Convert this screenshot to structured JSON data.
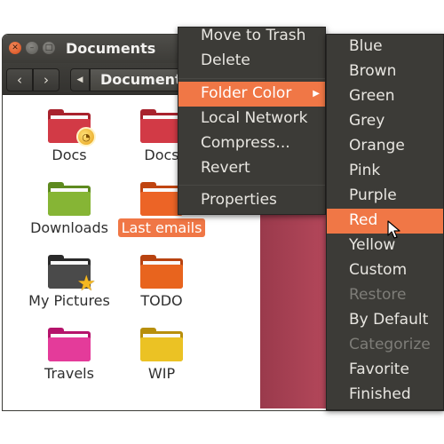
{
  "window": {
    "title": "Documents",
    "breadcrumb": "Documents"
  },
  "files": [
    {
      "name": "Docs",
      "color": "#c8303c",
      "emblem": "clock-emblem"
    },
    {
      "name": "Docs",
      "color": "#c8303c",
      "emblem": ""
    },
    {
      "name": "Downloads",
      "color": "#7cab2f",
      "emblem": ""
    },
    {
      "name": "Last emails",
      "color": "#e85b20",
      "emblem": "",
      "selected": true
    },
    {
      "name": "My Pictures",
      "color": "#3f3f3f",
      "emblem": "star-emblem"
    },
    {
      "name": "TODO",
      "color": "#e05a17",
      "emblem": ""
    },
    {
      "name": "Travels",
      "color": "#e0318f",
      "emblem": ""
    },
    {
      "name": "WIP",
      "color": "#e3b81a",
      "emblem": ""
    }
  ],
  "context_menu": {
    "items": [
      {
        "label": "Move to Trash"
      },
      {
        "label": "Delete"
      },
      {
        "label": "Folder Color",
        "highlighted": true,
        "has_submenu": true
      },
      {
        "label": "Local Network"
      },
      {
        "label": "Compress..."
      },
      {
        "label": "Revert"
      },
      {
        "label": "Properties"
      }
    ]
  },
  "color_submenu": {
    "items": [
      {
        "label": "Blue"
      },
      {
        "label": "Brown"
      },
      {
        "label": "Green"
      },
      {
        "label": "Grey"
      },
      {
        "label": "Orange"
      },
      {
        "label": "Pink"
      },
      {
        "label": "Purple"
      },
      {
        "label": "Red",
        "highlighted": true
      },
      {
        "label": "Yellow"
      },
      {
        "label": "Custom"
      },
      {
        "label": "Restore",
        "disabled": true
      },
      {
        "label": "By Default"
      },
      {
        "label": "Categorize",
        "disabled": true
      },
      {
        "label": "Favorite"
      },
      {
        "label": "Finished"
      }
    ]
  },
  "colors": {
    "accent": "#f07746",
    "menu_bg": "#3c3b37"
  }
}
